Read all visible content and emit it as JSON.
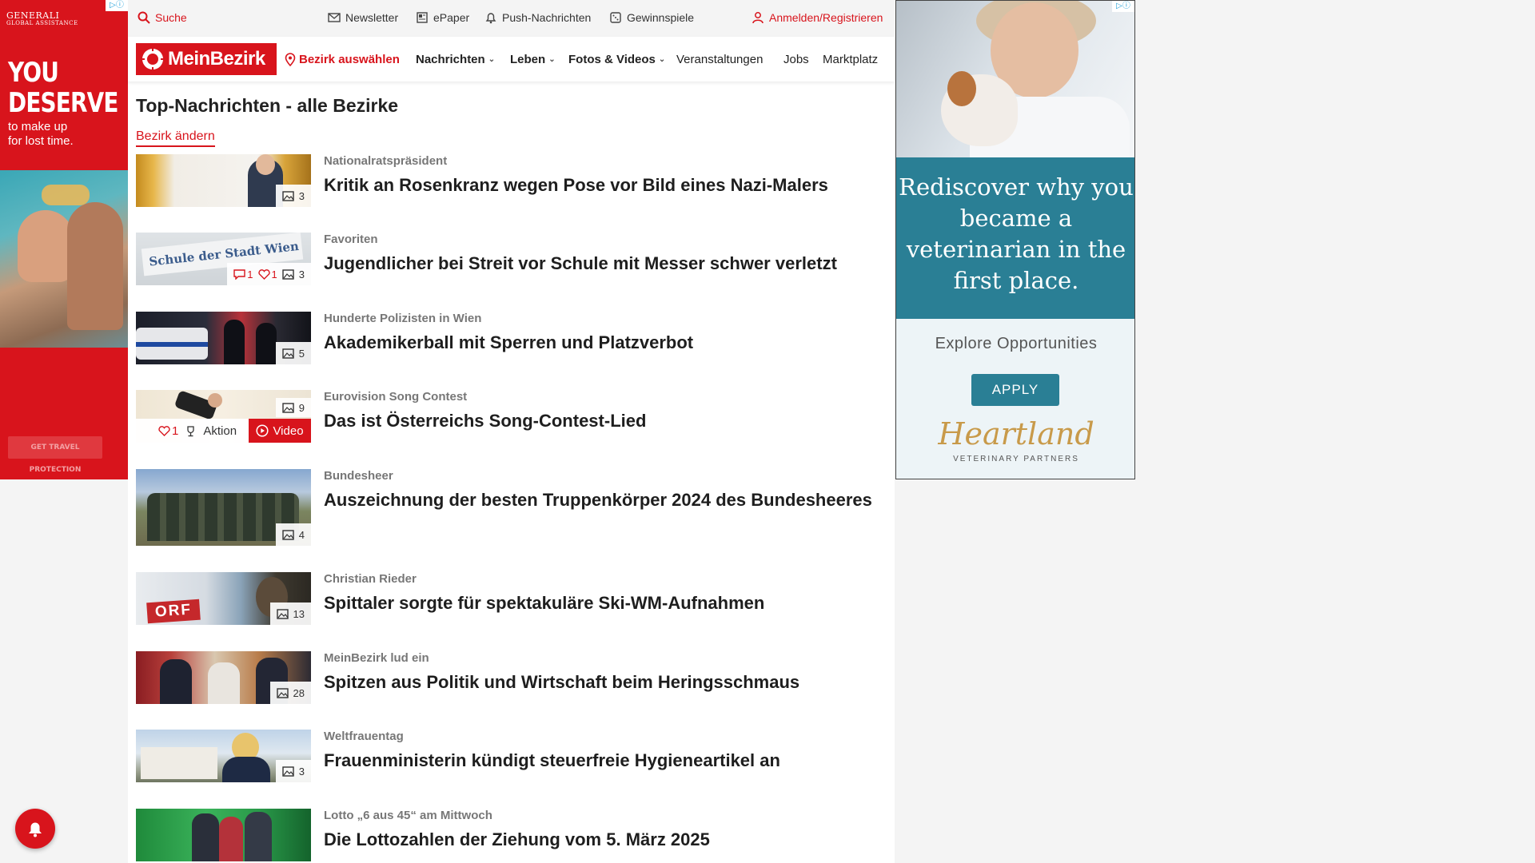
{
  "ad_left": {
    "brand": "GENERALI",
    "brand_sub": "GLOBAL ASSISTANCE",
    "headline_1": "YOU",
    "headline_2": "DESERVE",
    "sub_1": "to make up",
    "sub_2": "for lost time.",
    "cta": "GET TRAVEL PROTECTION"
  },
  "utility": {
    "search": "Suche",
    "newsletter": "Newsletter",
    "epaper": "ePaper",
    "push": "Push-Nachrichten",
    "gewinnspiele": "Gewinnspiele",
    "login": "Anmelden/Registrieren"
  },
  "nav": {
    "logo": "MeinBezirk",
    "bezirk": "Bezirk auswählen",
    "nachrichten": "Nachrichten",
    "leben": "Leben",
    "fotos": "Fotos & Videos",
    "veranstaltungen": "Veranstaltungen",
    "jobs": "Jobs",
    "marktplatz": "Marktplatz"
  },
  "section": {
    "title": "Top-Nachrichten - alle Bezirke",
    "change": "Bezirk ändern"
  },
  "articles": [
    {
      "kicker": "Nationalratspräsident",
      "title": "Kritik an Rosenkranz wegen Pose vor Bild eines Nazi-Malers",
      "photos": "3"
    },
    {
      "kicker": "Favoriten",
      "title": "Jugendlicher bei Streit vor Schule mit Messer schwer verletzt",
      "comments": "1",
      "likes": "1",
      "photos": "3"
    },
    {
      "kicker": "Hunderte Polizisten in Wien",
      "title": "Akademikerball mit Sperren und Platzverbot",
      "photos": "5"
    },
    {
      "kicker": "Eurovision Song Contest",
      "title": "Das ist Österreichs Song-Contest-Lied",
      "photos": "9",
      "likes": "1",
      "aktion": "Aktion",
      "video": "Video"
    },
    {
      "kicker": "Bundesheer",
      "title": "Auszeichnung der besten Truppenkörper 2024 des Bundesheeres",
      "photos": "4"
    },
    {
      "kicker": "Christian Rieder",
      "title": "Spittaler sorgte für spektakuläre Ski-WM-Aufnahmen",
      "photos": "13",
      "thumb_text": "ORF"
    },
    {
      "kicker": "MeinBezirk lud ein",
      "title": "Spitzen aus Politik und Wirtschaft beim Heringsschmaus",
      "photos": "28"
    },
    {
      "kicker": "Weltfrauentag",
      "title": "Frauenministerin kündigt steuerfreie Hygieneartikel an",
      "photos": "3"
    },
    {
      "kicker": "Lotto „6 aus 45“ am Mittwoch",
      "title": "Die Lottozahlen der Ziehung vom 5. März 2025"
    }
  ],
  "thumb_school_sign": "Schule der Stadt Wien",
  "ad_right": {
    "headline": "Rediscover why you became a veterinarian in the first place.",
    "explore": "Explore Opportunities",
    "apply": "APPLY",
    "brand": "Heartland",
    "brand_sub": "VETERINARY PARTNERS"
  },
  "colors": {
    "brand_red": "#d8141c",
    "ad_teal": "#2a7f95"
  }
}
